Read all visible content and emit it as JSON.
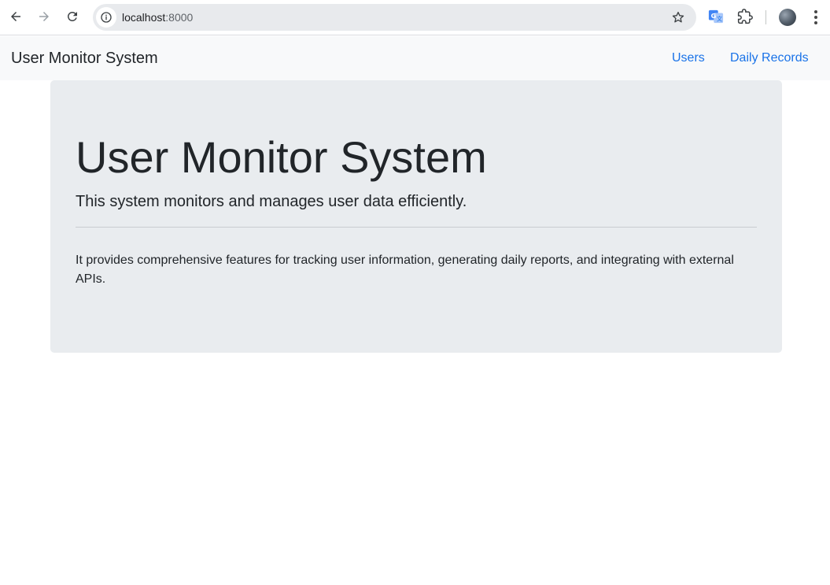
{
  "browser": {
    "url_host": "localhost",
    "url_port": ":8000",
    "icons": {
      "back": "arrow-back-icon",
      "forward": "arrow-forward-icon",
      "reload": "reload-icon",
      "site_info": "info-icon",
      "bookmark": "star-icon",
      "translate": "google-translate-icon",
      "extensions": "puzzle-icon",
      "profile": "avatar",
      "menu": "kebab-menu-icon"
    }
  },
  "navbar": {
    "brand": "User Monitor System",
    "links": [
      {
        "label": "Users"
      },
      {
        "label": "Daily Records"
      }
    ],
    "link_color": "#1a73e8"
  },
  "jumbotron": {
    "title": "User Monitor System",
    "lead": "This system monitors and manages user data efficiently.",
    "body": "It provides comprehensive features for tracking user information, generating daily reports, and integrating with external APIs.",
    "background": "#e9ecef"
  }
}
